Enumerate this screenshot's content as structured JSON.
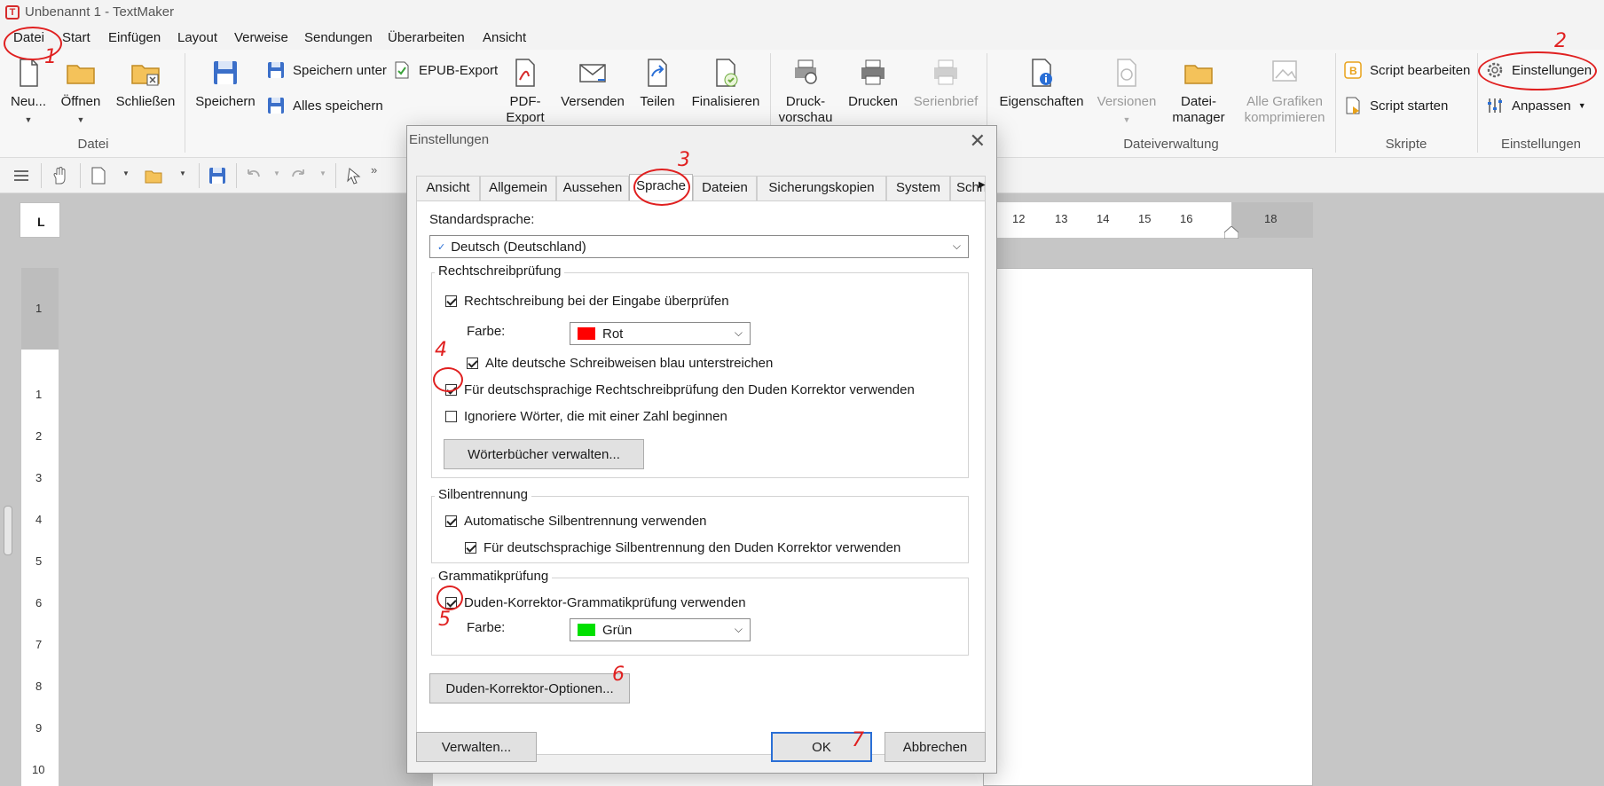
{
  "window": {
    "title": "Unbenannt 1 - TextMaker",
    "logo_letter": "T"
  },
  "menu": [
    "Datei",
    "Start",
    "Einfügen",
    "Layout",
    "Verweise",
    "Sendungen",
    "Überarbeiten",
    "Ansicht"
  ],
  "ribbon": {
    "datei": {
      "neu": "Neu...",
      "oeffnen": "Öffnen",
      "schliessen": "Schließen",
      "group": "Datei"
    },
    "save": {
      "speichern": "Speichern",
      "speichern_unter": "Speichern unter",
      "alles_speichern": "Alles speichern",
      "epub": "EPUB-Export",
      "pdf": "PDF-Export",
      "versenden": "Versenden",
      "teilen": "Teilen",
      "finalisieren": "Finalisieren"
    },
    "print": {
      "druckvorschau": "Druck-vorschau",
      "drucken": "Drucken",
      "serienbrief": "Serienbrief"
    },
    "dateiverwaltung": {
      "eigenschaften": "Eigenschaften",
      "versionen": "Versionen",
      "dateimanager_1": "Datei-",
      "dateimanager_2": "manager",
      "grafiken_1": "Alle Grafiken",
      "grafiken_2": "komprimieren",
      "group": "Dateiverwaltung"
    },
    "skripte": {
      "bearbeiten": "Script bearbeiten",
      "starten": "Script starten",
      "group": "Skripte"
    },
    "einstellungen": {
      "einstellungen": "Einstellungen",
      "anpassen": "Anpassen",
      "group": "Einstellungen"
    }
  },
  "ruler": {
    "horizontal": [
      "12",
      "13",
      "14",
      "15",
      "16",
      "18"
    ],
    "vertical": [
      "1",
      "1",
      "2",
      "3",
      "4",
      "5",
      "6",
      "7",
      "8",
      "9",
      "10"
    ]
  },
  "dialog": {
    "title": "Einstellungen",
    "close": "✕",
    "tabs": [
      "Ansicht",
      "Allgemein",
      "Aussehen",
      "Sprache",
      "Dateien",
      "Sicherungskopien",
      "System",
      "Schri"
    ],
    "standardsprache_label": "Standardsprache:",
    "standardsprache_value": "Deutsch (Deutschland)",
    "rechtschreib": {
      "legend": "Rechtschreibprüfung",
      "eingabe": "Rechtschreibung bei der Eingabe überprüfen",
      "farbe_label": "Farbe:",
      "farbe_value": "Rot",
      "farbe_color": "#ff0000",
      "alte": "Alte deutsche Schreibweisen blau unterstreichen",
      "duden": "Für deutschsprachige Rechtschreibprüfung den Duden Korrektor verwenden",
      "ignoriere": "Ignoriere Wörter, die mit einer Zahl beginnen",
      "woerterbuecher": "Wörterbücher verwalten..."
    },
    "silben": {
      "legend": "Silbentrennung",
      "auto": "Automatische Silbentrennung verwenden",
      "duden": "Für deutschsprachige Silbentrennung den Duden Korrektor verwenden"
    },
    "grammatik": {
      "legend": "Grammatikprüfung",
      "duden": "Duden-Korrektor-Grammatikprüfung verwenden",
      "farbe_label": "Farbe:",
      "farbe_value": "Grün",
      "farbe_color": "#00e000"
    },
    "optionen_button": "Duden-Korrektor-Optionen...",
    "verwalten_button": "Verwalten...",
    "ok_button": "OK",
    "abbrechen_button": "Abbrechen"
  },
  "annotations": [
    "1",
    "2",
    "3",
    "4",
    "5",
    "6",
    "7"
  ]
}
